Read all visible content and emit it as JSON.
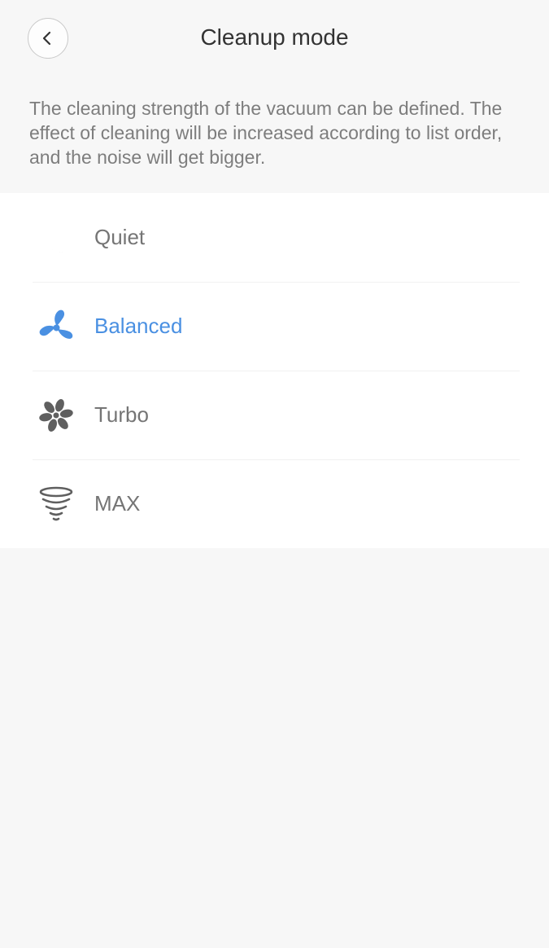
{
  "header": {
    "title": "Cleanup mode"
  },
  "description": "The cleaning strength of the vacuum can be defined. The effect of cleaning will be increased according to list order, and the noise will get bigger.",
  "modes": [
    {
      "label": "Quiet",
      "icon": "moon-icon",
      "selected": false
    },
    {
      "label": "Balanced",
      "icon": "fan-icon",
      "selected": true
    },
    {
      "label": "Turbo",
      "icon": "turbo-fan-icon",
      "selected": false
    },
    {
      "label": "MAX",
      "icon": "tornado-icon",
      "selected": false
    }
  ],
  "colors": {
    "accent": "#4a90e2",
    "text": "#757575",
    "icon": "#666666"
  }
}
